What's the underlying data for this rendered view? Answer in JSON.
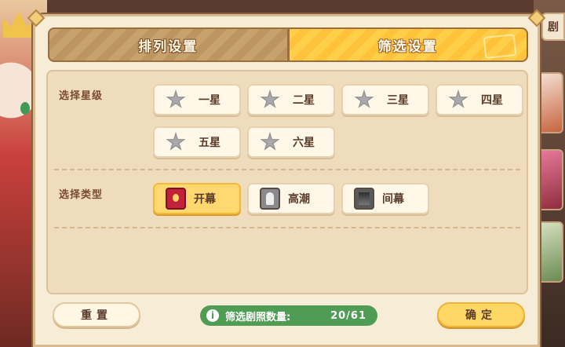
{
  "tabs": {
    "sort": "排列设置",
    "filter": "筛选设置"
  },
  "side": {
    "tab_label": "剧"
  },
  "star_section": {
    "label": "选择星级",
    "options": [
      "一星",
      "二星",
      "三星",
      "四星",
      "五星",
      "六星"
    ]
  },
  "type_section": {
    "label": "选择类型",
    "options": [
      {
        "label": "开幕",
        "icon": "curtain-open-icon",
        "selected": true
      },
      {
        "label": "高潮",
        "icon": "climax-icon",
        "selected": false
      },
      {
        "label": "间幕",
        "icon": "curtain-mid-icon",
        "selected": false
      }
    ]
  },
  "footer": {
    "reset": "重置",
    "confirm": "确定",
    "count_label": "筛选剧照数量:",
    "count_value": "20/61"
  },
  "colors": {
    "accent": "#ffd765",
    "count_pill": "#4f9c55",
    "panel": "#f7ecd6"
  }
}
